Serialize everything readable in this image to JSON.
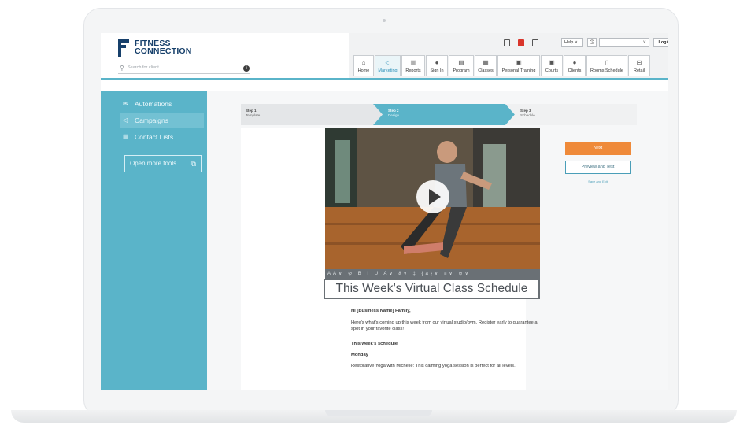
{
  "brand": {
    "line1": "FITNESS",
    "line2": "CONNECTION"
  },
  "search": {
    "placeholder": "Search for client"
  },
  "topbar": {
    "help_label": "Help ∨",
    "select_value": "∨",
    "logout_label": "Log Out"
  },
  "nav": [
    {
      "label": "Home",
      "icon": "home-icon",
      "glyph": "⌂"
    },
    {
      "label": "Marketing",
      "icon": "megaphone-icon",
      "glyph": "◁",
      "active": true
    },
    {
      "label": "Reports",
      "icon": "bar-chart-icon",
      "glyph": "▥"
    },
    {
      "label": "Sign In",
      "icon": "person-icon",
      "glyph": "●"
    },
    {
      "label": "Program",
      "icon": "calendar-icon",
      "glyph": "▤"
    },
    {
      "label": "Classes",
      "icon": "calendar-icon",
      "glyph": "▦"
    },
    {
      "label": "Personal Training",
      "icon": "calendar-icon",
      "glyph": "▣"
    },
    {
      "label": "Courts",
      "icon": "calendar-icon",
      "glyph": "▣"
    },
    {
      "label": "Clients",
      "icon": "person-icon",
      "glyph": "●"
    },
    {
      "label": "Rooms Schedule",
      "icon": "door-icon",
      "glyph": "▯"
    },
    {
      "label": "Retail",
      "icon": "basket-icon",
      "glyph": "⊟"
    }
  ],
  "sidebar": {
    "items": [
      {
        "label": "Automations",
        "icon": "envelope-icon"
      },
      {
        "label": "Campaigns",
        "icon": "megaphone-icon",
        "active": true
      },
      {
        "label": "Contact Lists",
        "icon": "contact-card-icon"
      }
    ],
    "open_tools_label": "Open more tools"
  },
  "steps": [
    {
      "number": "Step 1",
      "label": "Template"
    },
    {
      "number": "Step 2",
      "label": "Design",
      "active": true
    },
    {
      "number": "Step 3",
      "label": "Schedule"
    }
  ],
  "editor": {
    "toolbar": "AA∨ ⊘ B I U A∨ ∂∨ ‡ {a}∨ ≡∨ ⊘∨",
    "headline": "This Week’s Virtual Class Schedule",
    "greeting": "Hi [Business Name] Family,",
    "intro": "Here’s what’s coming up this week from our virtual studio/gym. Register early to guarantee a spot in your favorite class!",
    "section_title": "This week’s schedule",
    "day": "Monday",
    "class_desc": "Restorative Yoga with Michelle: This calming yoga session is perfect for all levels."
  },
  "actions": {
    "next_label": "Next",
    "preview_label": "Preview and Test",
    "save_exit_label": "Save and Exit"
  },
  "colors": {
    "teal": "#5ab4c9",
    "navy": "#17406b",
    "orange": "#ef8a3a"
  }
}
